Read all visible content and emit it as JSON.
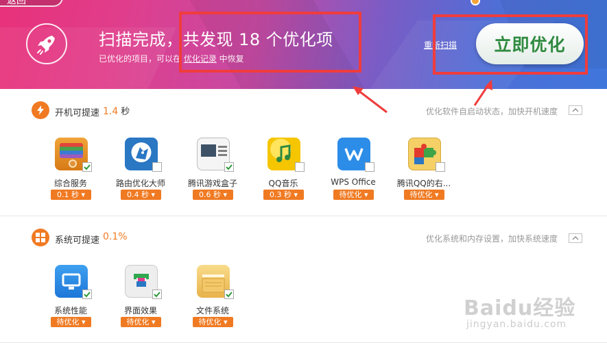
{
  "header": {
    "back_label": "返回",
    "scan_title": "扫描完成，共发现 18 个优化项",
    "subtitle_prefix": "已优化的项目，可以在 ",
    "subtitle_link": "优化记录",
    "subtitle_suffix": " 中恢复",
    "rescan_label": "重新扫描",
    "optimize_label": "立即优化",
    "rocket_icon": "rocket-icon"
  },
  "annotations": {
    "highlight_color": "#f03c3c"
  },
  "sections": [
    {
      "title": "开机可提速",
      "value": "1.4",
      "unit": "秒",
      "hint": "优化软件自启动状态，加快开机速度",
      "icon": "lightning-icon",
      "items": [
        {
          "label": "综合服务",
          "status": "0.1 秒 ▾",
          "checked": true,
          "icon": "service-drawer-icon"
        },
        {
          "label": "路由优化大师",
          "status": "0.4 秒 ▾",
          "checked": false,
          "icon": "router-master-icon"
        },
        {
          "label": "腾讯游戏盒子",
          "status": "0.6 秒 ▾",
          "checked": true,
          "icon": "game-box-icon"
        },
        {
          "label": "QQ音乐",
          "status": "0.3 秒 ▾",
          "checked": false,
          "icon": "qq-music-icon"
        },
        {
          "label": "WPS Office",
          "status": "待优化 ▾",
          "checked": false,
          "icon": "wps-office-icon"
        },
        {
          "label": "腾讯QQ的右...",
          "status": "待优化 ▾",
          "checked": false,
          "icon": "puzzle-plugin-icon"
        }
      ]
    },
    {
      "title": "系统可提速",
      "value": "0.1%",
      "unit": "",
      "hint": "优化系统和内存设置，加快系统速度",
      "icon": "windows-icon",
      "items": [
        {
          "label": "系统性能",
          "status": "待优化 ▾",
          "checked": true,
          "icon": "monitor-icon"
        },
        {
          "label": "界面效果",
          "status": "待优化 ▾",
          "checked": true,
          "icon": "interface-shirt-icon"
        },
        {
          "label": "文件系统",
          "status": "待优化 ▾",
          "checked": true,
          "icon": "folder-icon"
        }
      ]
    }
  ],
  "watermark": {
    "text": "Baidu经验",
    "url": "jingyan.baidu.com"
  },
  "colors": {
    "accent_orange": "#f07a22",
    "button_green": "#2f8a3f"
  }
}
